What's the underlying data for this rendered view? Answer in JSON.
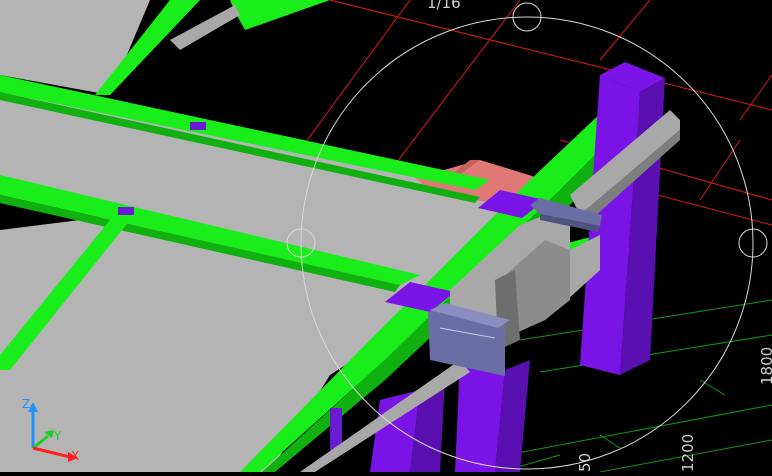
{
  "viewport": {
    "background": "#000000",
    "colors": {
      "slab": "#b4b4b4",
      "beam": "#1aee1a",
      "beam_dark": "#10b010",
      "column": "#7a14e6",
      "column_dark": "#5a0fb0",
      "bracket": "#a8a8a8",
      "plate": "#6b6ea4",
      "foundation": "#e08080",
      "grid_red": "#ff2020",
      "grid_green": "#0bb40b",
      "orbit": "#d8d8d8"
    },
    "grid_labels": {
      "top_fraction": "1/16",
      "dim_50": "50",
      "dim_1200": "1200",
      "dim_1800": "1800"
    },
    "ucs": {
      "z_label": "Z",
      "y_label": "Y",
      "x_label": "X",
      "z_color": "#1e90ff",
      "y_color": "#22cc22",
      "x_color": "#ff2020"
    },
    "orbit_tool": {
      "icon": "orbit-circle-icon",
      "handles": [
        "top-handle",
        "left-handle",
        "right-handle"
      ]
    }
  }
}
